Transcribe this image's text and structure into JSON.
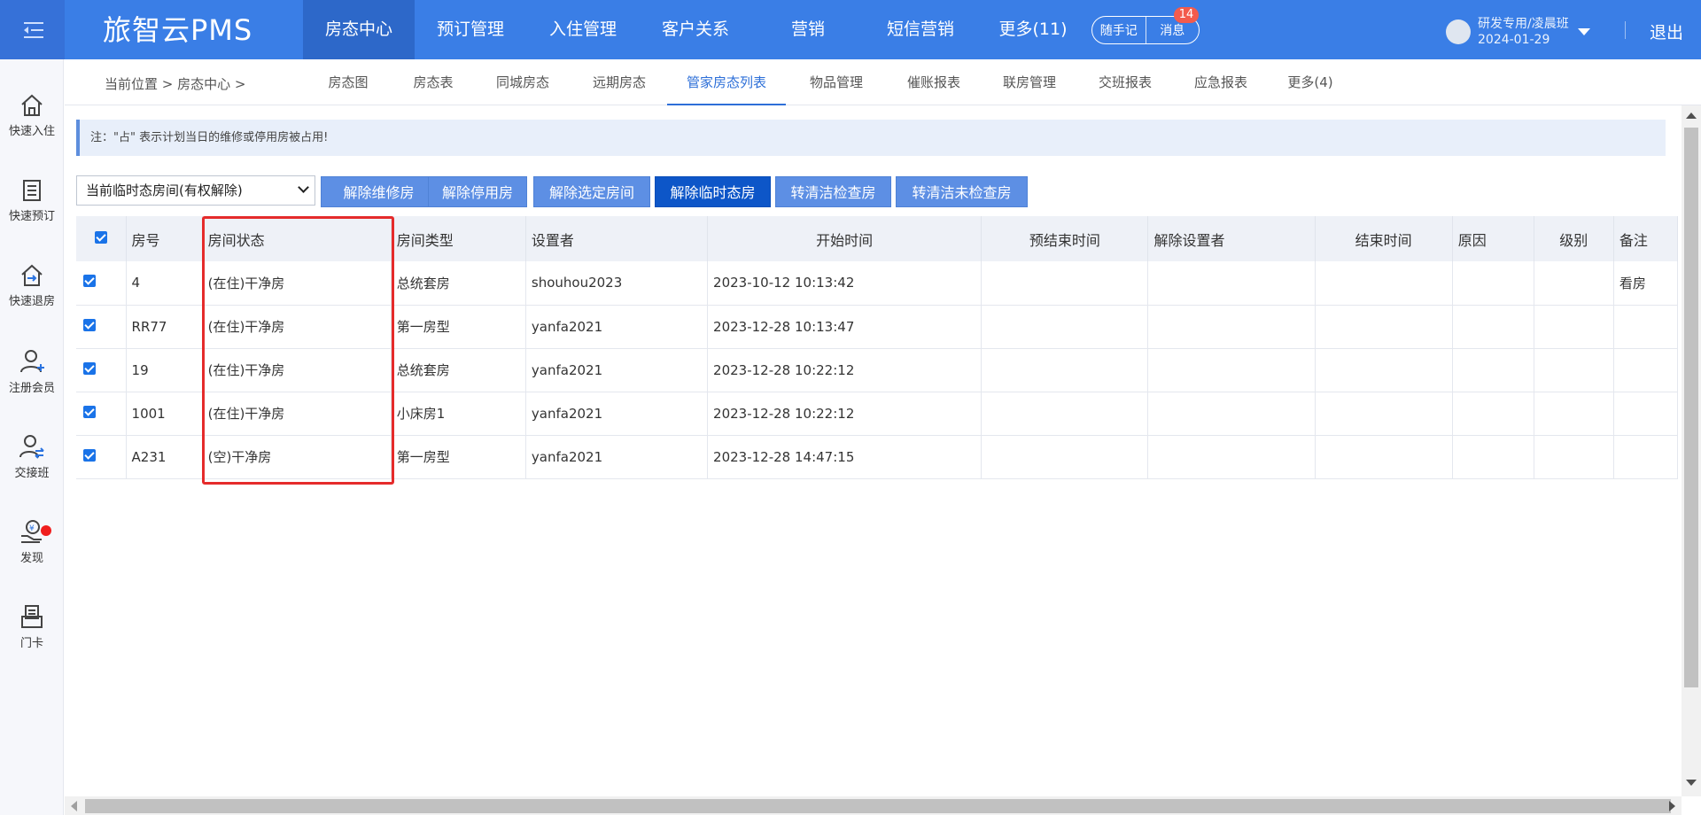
{
  "topbar": {
    "logo": "旅智云PMS",
    "nav": [
      {
        "label": "房态中心",
        "active": true
      },
      {
        "label": "预订管理",
        "active": false
      },
      {
        "label": "入住管理",
        "active": false
      },
      {
        "label": "客户关系",
        "active": false
      },
      {
        "label": "营销",
        "active": false
      },
      {
        "label": "短信营销",
        "active": false
      },
      {
        "label": "更多(11)",
        "active": false
      }
    ],
    "notes_button": "随手记",
    "messages_button": "消息",
    "message_count": "14",
    "user_name": "研发专用/凌晨班",
    "user_date": "2024-01-29",
    "logout": "退出"
  },
  "sidebar": {
    "items": [
      {
        "label": "快速入住",
        "icon": "home-icon"
      },
      {
        "label": "快速预订",
        "icon": "document-icon"
      },
      {
        "label": "快速退房",
        "icon": "checkout-icon"
      },
      {
        "label": "注册会员",
        "icon": "user-add-icon"
      },
      {
        "label": "交接班",
        "icon": "user-swap-icon"
      },
      {
        "label": "发现",
        "icon": "hand-coin-icon"
      },
      {
        "label": "门卡",
        "icon": "card-icon"
      }
    ]
  },
  "breadcrumb": "当前位置 > 房态中心 >",
  "subtabs": [
    {
      "label": "房态图",
      "active": false
    },
    {
      "label": "房态表",
      "active": false
    },
    {
      "label": "同城房态",
      "active": false
    },
    {
      "label": "远期房态",
      "active": false
    },
    {
      "label": "管家房态列表",
      "active": true
    },
    {
      "label": "物品管理",
      "active": false
    },
    {
      "label": "催账报表",
      "active": false
    },
    {
      "label": "联房管理",
      "active": false
    },
    {
      "label": "交班报表",
      "active": false
    },
    {
      "label": "应急报表",
      "active": false
    },
    {
      "label": "更多(4)",
      "active": false
    }
  ],
  "notice": "注：\"占\" 表示计划当日的维修或停用房被占用!",
  "filter_select": "当前临时态房间(有权解除)",
  "buttons": [
    {
      "label": "解除维修房"
    },
    {
      "label": "解除停用房"
    },
    {
      "label": "解除选定房间"
    },
    {
      "label": "解除临时态房"
    },
    {
      "label": "转清洁检查房"
    },
    {
      "label": "转清洁未检查房"
    }
  ],
  "table": {
    "headers": [
      "房号",
      "房间状态",
      "房间类型",
      "设置者",
      "开始时间",
      "预结束时间",
      "解除设置者",
      "结束时间",
      "原因",
      "级别",
      "备注"
    ],
    "rows": [
      {
        "room": "4",
        "status": "(在住)干净房",
        "type": "总统套房",
        "setter": "shouhou2023",
        "start": "2023-10-12 10:13:42",
        "planned_end": "",
        "releaser": "",
        "end": "",
        "reason": "",
        "level": "",
        "note": "看房"
      },
      {
        "room": "RR77",
        "status": "(在住)干净房",
        "type": "第一房型",
        "setter": "yanfa2021",
        "start": "2023-12-28 10:13:47",
        "planned_end": "",
        "releaser": "",
        "end": "",
        "reason": "",
        "level": "",
        "note": ""
      },
      {
        "room": "19",
        "status": "(在住)干净房",
        "type": "总统套房",
        "setter": "yanfa2021",
        "start": "2023-12-28 10:22:12",
        "planned_end": "",
        "releaser": "",
        "end": "",
        "reason": "",
        "level": "",
        "note": ""
      },
      {
        "room": "1001",
        "status": "(在住)干净房",
        "type": "小床房1",
        "setter": "yanfa2021",
        "start": "2023-12-28 10:22:12",
        "planned_end": "",
        "releaser": "",
        "end": "",
        "reason": "",
        "level": "",
        "note": ""
      },
      {
        "room": "A231",
        "status": "(空)干净房",
        "type": "第一房型",
        "setter": "yanfa2021",
        "start": "2023-12-28 14:47:15",
        "planned_end": "",
        "releaser": "",
        "end": "",
        "reason": "",
        "level": "",
        "note": ""
      }
    ]
  }
}
